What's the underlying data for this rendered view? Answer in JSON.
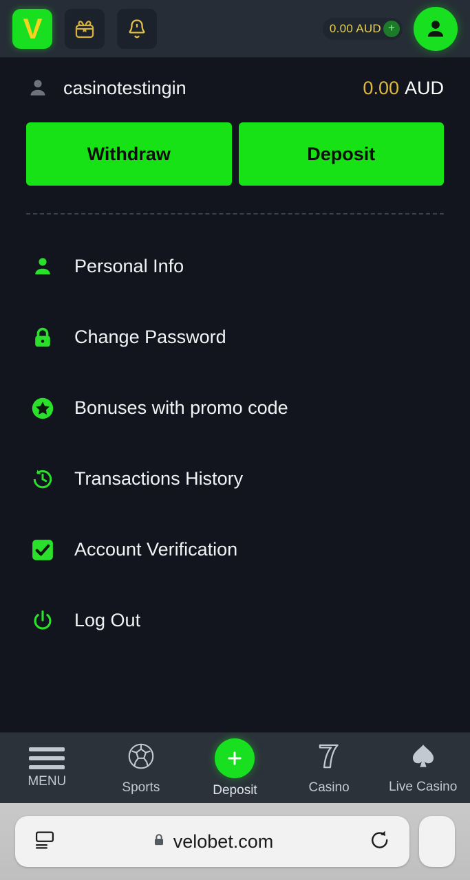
{
  "header": {
    "logo_letter": "V",
    "logo_name": "velobet-logo",
    "gift_icon": "gift-icon",
    "bell_icon": "bell-icon",
    "balance_amount": "0.00 AUD",
    "plus_label": "+",
    "avatar_icon": "person-icon"
  },
  "account": {
    "user_icon": "person-icon",
    "username": "casinotestingin",
    "balance_number": "0.00",
    "balance_currency": "AUD",
    "withdraw_label": "Withdraw",
    "deposit_label": "Deposit"
  },
  "menu": {
    "items": [
      {
        "label": "Personal Info",
        "icon": "person-icon"
      },
      {
        "label": "Change Password",
        "icon": "lock-icon"
      },
      {
        "label": "Bonuses with promo code",
        "icon": "star-circle-icon"
      },
      {
        "label": "Transactions History",
        "icon": "history-clock-icon"
      },
      {
        "label": "Account Verification",
        "icon": "check-square-icon"
      },
      {
        "label": "Log Out",
        "icon": "power-icon"
      }
    ]
  },
  "bottom_nav": {
    "items": [
      {
        "label": "MENU",
        "icon": "hamburger-icon"
      },
      {
        "label": "Sports",
        "icon": "soccer-ball-icon"
      },
      {
        "label": "Deposit",
        "icon": "plus-circle-icon"
      },
      {
        "label": "Casino",
        "icon": "slot-seven-icon"
      },
      {
        "label": "Live Casino",
        "icon": "spade-icon"
      }
    ]
  },
  "browser": {
    "reader_icon": "reader-view-icon",
    "lock_icon": "lock-icon",
    "url": "velobet.com",
    "reload_icon": "reload-icon"
  },
  "colors": {
    "accent_green": "#18e020",
    "gold": "#e0b93a",
    "header_bg": "#262d36",
    "page_bg": "#12151d",
    "nav_bg": "#2b323a"
  }
}
